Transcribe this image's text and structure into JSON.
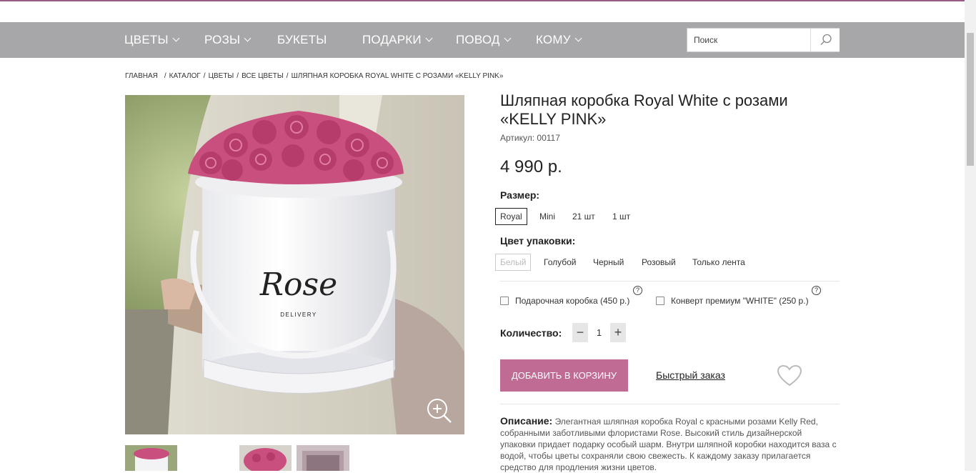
{
  "nav": {
    "items": [
      {
        "label": "ЦВЕТЫ",
        "dropdown": true
      },
      {
        "label": "РОЗЫ",
        "dropdown": true
      },
      {
        "label": "БУКЕТЫ",
        "dropdown": false
      },
      {
        "label": "ПОДАРКИ",
        "dropdown": true
      },
      {
        "label": "ПОВОД",
        "dropdown": true
      },
      {
        "label": "КОМУ",
        "dropdown": true
      }
    ],
    "search_placeholder": "Поиск"
  },
  "breadcrumb": [
    "Главная",
    "Каталог",
    "Цветы",
    "Все цветы",
    "Шляпная коробка Royal White с розами «Kelly Pink»"
  ],
  "product": {
    "title": "Шляпная коробка Royal White с розами «KELLY PINK»",
    "article": "Артикул: 00117",
    "price": "4 990 р.",
    "photo_logo": "Rose",
    "photo_logo_sub": "DELIVERY",
    "size_label": "Размер:",
    "sizes": [
      "Royal",
      "Mini",
      "21 шт",
      "1 шт"
    ],
    "pack_label": "Цвет упаковки:",
    "pack_colors": [
      "Белый",
      "Голубой",
      "Черный",
      "Розовый",
      "Только лента"
    ],
    "addons": [
      "Подарочная коробка (450 р.)",
      "Конверт премиум \"WHITE\" (250 р.)"
    ],
    "help_mark": "?",
    "qty_label": "Количество:",
    "qty_value": "1",
    "qty_minus": "−",
    "qty_plus": "+",
    "add_to_cart": "Добавить в корзину",
    "quick_order": "Быстрый заказ",
    "desc_label": "Описание:",
    "description": "Элегантная шляпная коробка Royal с красными розами Kelly Red, собранными заботливыми флористами Rose. Высокий стиль дизайнерской упаковки придает подарку особый шарм. Внутри шляпной коробки находится ваза с водой, чтобы цветы сохраняли свою свежесть. К каждому заказу прилагается средство для продления жизни цветов."
  },
  "colors": {
    "accent": "#c06b93",
    "nav_bg": "#a7a6a8",
    "rose": "#c94f7e"
  }
}
